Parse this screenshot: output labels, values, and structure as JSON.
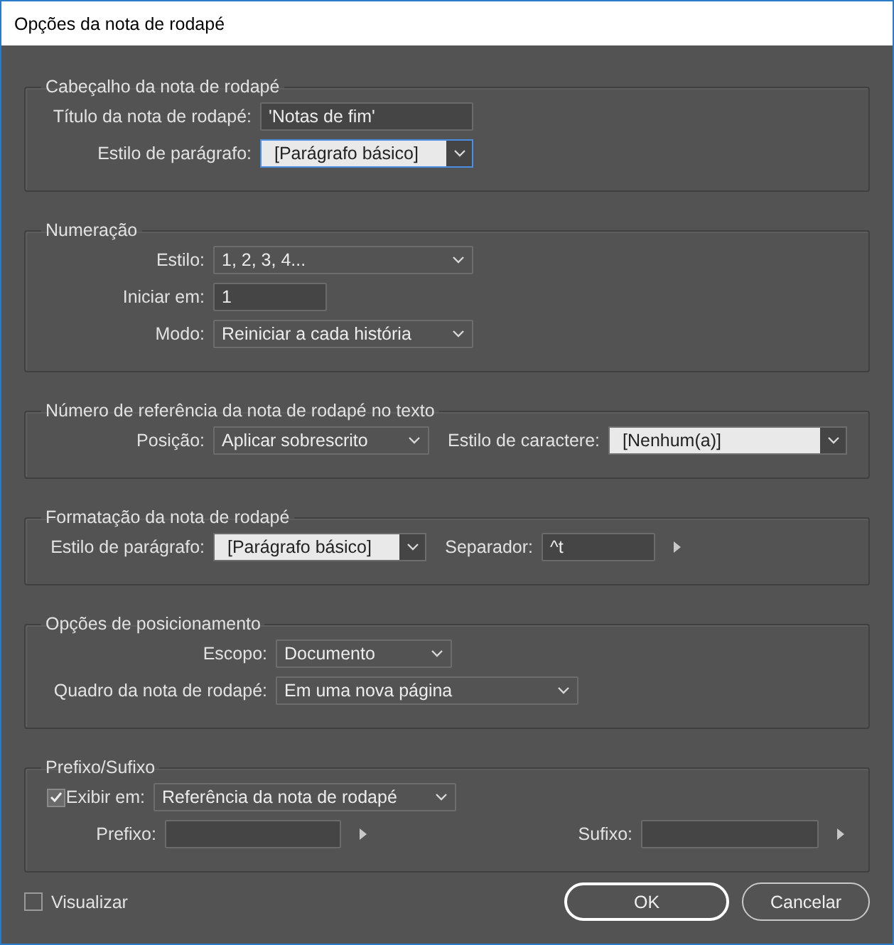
{
  "window": {
    "title": "Opções da nota de rodapé"
  },
  "groups": [
    {
      "title": "Cabeçalho da nota de rodapé",
      "rows": [
        [
          {
            "kind": "field",
            "label": "Título da nota de rodapé:",
            "value": "'Notas de fim'"
          }
        ],
        [
          {
            "kind": "combo",
            "label": "Estilo de parágrafo:",
            "value": "[Parágrafo básico]",
            "focused": true
          }
        ]
      ]
    },
    {
      "title": "Numeração",
      "rows": [
        [
          {
            "kind": "dropdown",
            "label": "Estilo:",
            "value": "1, 2, 3, 4..."
          }
        ],
        [
          {
            "kind": "field",
            "label": "Iniciar em:",
            "value": "1"
          }
        ],
        [
          {
            "kind": "dropdown",
            "label": "Modo:",
            "value": "Reiniciar a cada história"
          }
        ]
      ]
    },
    {
      "title": "Número de referência da nota de rodapé no texto",
      "rows": [
        [
          {
            "kind": "dropdown",
            "label": "Posição:",
            "value": "Aplicar sobrescrito"
          },
          {
            "kind": "combo",
            "label": "Estilo de caractere:",
            "value": "[Nenhum(a)]",
            "focused": false
          }
        ]
      ]
    },
    {
      "title": "Formatação da nota de rodapé",
      "rows": [
        [
          {
            "kind": "combo",
            "label": "Estilo de parágrafo:",
            "value": "[Parágrafo básico]",
            "focused": false
          },
          {
            "kind": "field",
            "label": "Separador:",
            "value": "^t",
            "menu": true
          }
        ]
      ]
    },
    {
      "title": "Opções de posicionamento",
      "rows": [
        [
          {
            "kind": "dropdown",
            "label": "Escopo:",
            "value": "Documento"
          }
        ],
        [
          {
            "kind": "dropdown",
            "label": "Quadro da nota de rodapé:",
            "value": "Em uma nova página"
          }
        ]
      ]
    },
    {
      "title": "Prefixo/Sufixo",
      "rows": [
        [
          {
            "kind": "checkdrop",
            "label": "Exibir em:",
            "checked": true,
            "value": "Referência da nota de rodapé"
          }
        ],
        [
          {
            "kind": "field",
            "label": "Prefixo:",
            "menu": true
          },
          {
            "kind": "field",
            "label": "Sufixo:",
            "menu": true
          }
        ]
      ]
    }
  ],
  "preview": {
    "label": "Visualizar",
    "checked": false
  },
  "buttons": [
    {
      "label": "OK",
      "default": true
    },
    {
      "label": "Cancelar",
      "default": false
    }
  ]
}
